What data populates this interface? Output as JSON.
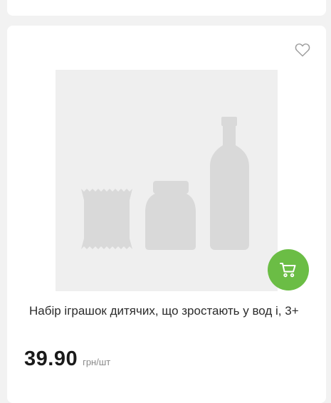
{
  "product": {
    "title": "Набір іграшок дитячих, що зростають у вод і, 3+",
    "price": "39.90",
    "unit": "грн/шт"
  },
  "icons": {
    "favorite": "heart-outline-icon",
    "cart": "shopping-cart-icon",
    "placeholder": "product-placeholder-image"
  },
  "colors": {
    "accent": "#6bbd45",
    "placeholder_bg": "#efefef",
    "placeholder_shape": "#d9d9d9"
  }
}
